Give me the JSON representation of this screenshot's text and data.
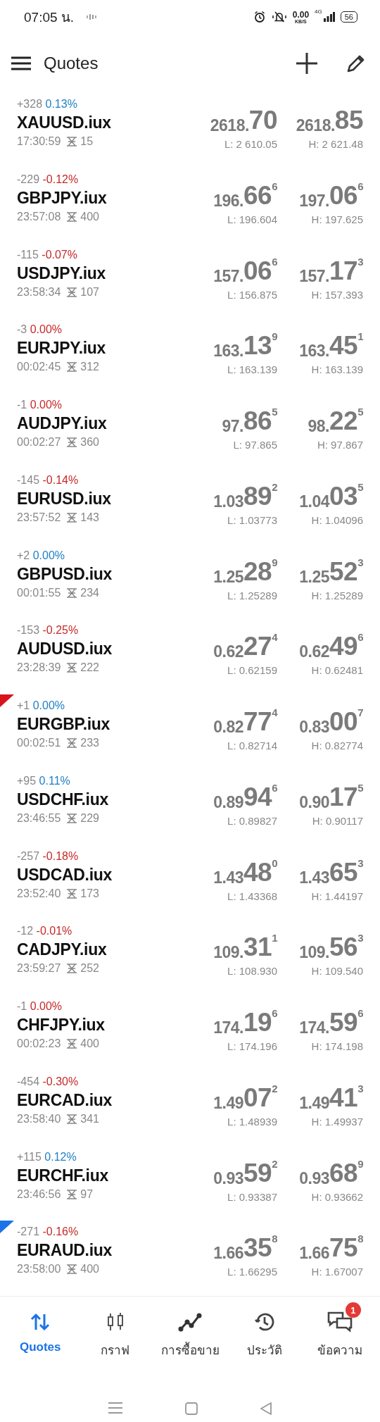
{
  "status_bar": {
    "time": "07:05 น.",
    "speed": "0.00",
    "speed_unit": "KB/S",
    "network": "4G",
    "battery": "56"
  },
  "header": {
    "title": "Quotes"
  },
  "quotes": [
    {
      "change": "+328",
      "percent": "0.13%",
      "color": "#1f7fc4",
      "symbol": "XAUUSD.iux",
      "time": "17:30:59",
      "spread": "15",
      "bid": {
        "prefix": "2618.",
        "big": "70"
      },
      "ask": {
        "prefix": "2618.",
        "big": "85"
      },
      "low": "L: 2 610.05",
      "high": "H: 2 621.48"
    },
    {
      "change": "-229",
      "percent": "-0.12%",
      "color": "#c62828",
      "symbol": "GBPJPY.iux",
      "time": "23:57:08",
      "spread": "400",
      "bid": {
        "prefix": "196.",
        "big": "66",
        "sup": "6"
      },
      "ask": {
        "prefix": "197.",
        "big": "06",
        "sup": "6"
      },
      "low": "L: 196.604",
      "high": "H: 197.625"
    },
    {
      "change": "-115",
      "percent": "-0.07%",
      "color": "#c62828",
      "symbol": "USDJPY.iux",
      "time": "23:58:34",
      "spread": "107",
      "bid": {
        "prefix": "157.",
        "big": "06",
        "sup": "6"
      },
      "ask": {
        "prefix": "157.",
        "big": "17",
        "sup": "3"
      },
      "low": "L: 156.875",
      "high": "H: 157.393"
    },
    {
      "change": "-3",
      "percent": "0.00%",
      "color": "#c62828",
      "symbol": "EURJPY.iux",
      "time": "00:02:45",
      "spread": "312",
      "bid": {
        "prefix": "163.",
        "big": "13",
        "sup": "9"
      },
      "ask": {
        "prefix": "163.",
        "big": "45",
        "sup": "1"
      },
      "low": "L: 163.139",
      "high": "H: 163.139"
    },
    {
      "change": "-1",
      "percent": "0.00%",
      "color": "#c62828",
      "symbol": "AUDJPY.iux",
      "time": "00:02:27",
      "spread": "360",
      "bid": {
        "prefix": "97.",
        "big": "86",
        "sup": "5"
      },
      "ask": {
        "prefix": "98.",
        "big": "22",
        "sup": "5"
      },
      "low": "L: 97.865",
      "high": "H: 97.867"
    },
    {
      "change": "-145",
      "percent": "-0.14%",
      "color": "#c62828",
      "symbol": "EURUSD.iux",
      "time": "23:57:52",
      "spread": "143",
      "bid": {
        "prefix": "1.03",
        "big": "89",
        "sup": "2"
      },
      "ask": {
        "prefix": "1.04",
        "big": "03",
        "sup": "5"
      },
      "low": "L: 1.03773",
      "high": "H: 1.04096"
    },
    {
      "change": "+2",
      "percent": "0.00%",
      "color": "#1f7fc4",
      "symbol": "GBPUSD.iux",
      "time": "00:01:55",
      "spread": "234",
      "bid": {
        "prefix": "1.25",
        "big": "28",
        "sup": "9"
      },
      "ask": {
        "prefix": "1.25",
        "big": "52",
        "sup": "3"
      },
      "low": "L: 1.25289",
      "high": "H: 1.25289"
    },
    {
      "change": "-153",
      "percent": "-0.25%",
      "color": "#c62828",
      "symbol": "AUDUSD.iux",
      "time": "23:28:39",
      "spread": "222",
      "bid": {
        "prefix": "0.62",
        "big": "27",
        "sup": "4"
      },
      "ask": {
        "prefix": "0.62",
        "big": "49",
        "sup": "6"
      },
      "low": "L: 0.62159",
      "high": "H: 0.62481"
    },
    {
      "change": "+1",
      "percent": "0.00%",
      "color": "#1f7fc4",
      "symbol": "EURGBP.iux",
      "time": "00:02:51",
      "spread": "233",
      "bid": {
        "prefix": "0.82",
        "big": "77",
        "sup": "4"
      },
      "ask": {
        "prefix": "0.83",
        "big": "00",
        "sup": "7"
      },
      "low": "L: 0.82714",
      "high": "H: 0.82774",
      "flag": {
        "color": "#d9131c"
      }
    },
    {
      "change": "+95",
      "percent": "0.11%",
      "color": "#1f7fc4",
      "symbol": "USDCHF.iux",
      "time": "23:46:55",
      "spread": "229",
      "bid": {
        "prefix": "0.89",
        "big": "94",
        "sup": "6"
      },
      "ask": {
        "prefix": "0.90",
        "big": "17",
        "sup": "5"
      },
      "low": "L: 0.89827",
      "high": "H: 0.90117"
    },
    {
      "change": "-257",
      "percent": "-0.18%",
      "color": "#c62828",
      "symbol": "USDCAD.iux",
      "time": "23:52:40",
      "spread": "173",
      "bid": {
        "prefix": "1.43",
        "big": "48",
        "sup": "0"
      },
      "ask": {
        "prefix": "1.43",
        "big": "65",
        "sup": "3"
      },
      "low": "L: 1.43368",
      "high": "H: 1.44197"
    },
    {
      "change": "-12",
      "percent": "-0.01%",
      "color": "#c62828",
      "symbol": "CADJPY.iux",
      "time": "23:59:27",
      "spread": "252",
      "bid": {
        "prefix": "109.",
        "big": "31",
        "sup": "1"
      },
      "ask": {
        "prefix": "109.",
        "big": "56",
        "sup": "3"
      },
      "low": "L: 108.930",
      "high": "H: 109.540"
    },
    {
      "change": "-1",
      "percent": "0.00%",
      "color": "#c62828",
      "symbol": "CHFJPY.iux",
      "time": "00:02:23",
      "spread": "400",
      "bid": {
        "prefix": "174.",
        "big": "19",
        "sup": "6"
      },
      "ask": {
        "prefix": "174.",
        "big": "59",
        "sup": "6"
      },
      "low": "L: 174.196",
      "high": "H: 174.198"
    },
    {
      "change": "-454",
      "percent": "-0.30%",
      "color": "#c62828",
      "symbol": "EURCAD.iux",
      "time": "23:58:40",
      "spread": "341",
      "bid": {
        "prefix": "1.49",
        "big": "07",
        "sup": "2"
      },
      "ask": {
        "prefix": "1.49",
        "big": "41",
        "sup": "3"
      },
      "low": "L: 1.48939",
      "high": "H: 1.49937"
    },
    {
      "change": "+115",
      "percent": "0.12%",
      "color": "#1f7fc4",
      "symbol": "EURCHF.iux",
      "time": "23:46:56",
      "spread": "97",
      "bid": {
        "prefix": "0.93",
        "big": "59",
        "sup": "2"
      },
      "ask": {
        "prefix": "0.93",
        "big": "68",
        "sup": "9"
      },
      "low": "L: 0.93387",
      "high": "H: 0.93662"
    },
    {
      "change": "-271",
      "percent": "-0.16%",
      "color": "#c62828",
      "symbol": "EURAUD.iux",
      "time": "23:58:00",
      "spread": "400",
      "bid": {
        "prefix": "1.66",
        "big": "35",
        "sup": "8"
      },
      "ask": {
        "prefix": "1.66",
        "big": "75",
        "sup": "8"
      },
      "low": "L: 1.66295",
      "high": "H: 1.67007",
      "flag": {
        "color": "#1a73e8"
      }
    }
  ],
  "bottom_nav": [
    {
      "kind": "quotes",
      "label": "Quotes",
      "selected": true
    },
    {
      "kind": "chart",
      "label": "กราฟ",
      "selected": false
    },
    {
      "kind": "trade",
      "label": "การซื้อขาย",
      "selected": false
    },
    {
      "kind": "history",
      "label": "ประวัติ",
      "selected": false
    },
    {
      "kind": "messages",
      "label": "ข้อความ",
      "selected": false,
      "badge": "1"
    }
  ]
}
